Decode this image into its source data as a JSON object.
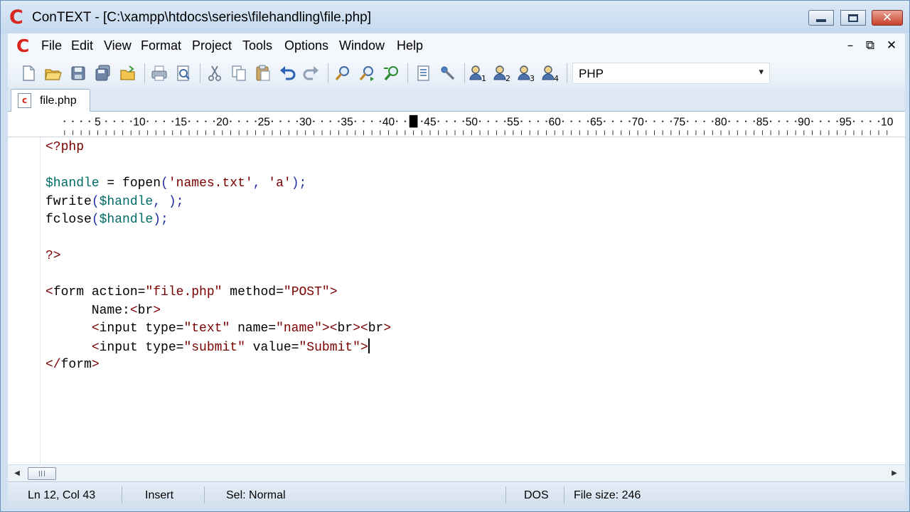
{
  "window": {
    "title": "ConTEXT - [C:\\xampp\\htdocs\\series\\filehandling\\file.php]",
    "app_logo": "C",
    "controls": {
      "minimize": "minimize-icon",
      "maximize": "maximize-icon",
      "close": "close-icon"
    },
    "close_color": "#c7402a"
  },
  "menu": {
    "logo": "C",
    "items": [
      "File",
      "Edit",
      "View",
      "Format",
      "Project",
      "Tools",
      "Options",
      "Window",
      "Help"
    ],
    "mdi_controls": {
      "minimize": "–",
      "restore": "⧉",
      "close": "✕"
    }
  },
  "toolbar": {
    "icons": [
      "new-file-icon",
      "open-file-icon",
      "save-icon",
      "save-all-icon",
      "open-folder-icon",
      "print-icon",
      "print-preview-icon",
      "cut-icon",
      "copy-icon",
      "paste-icon",
      "undo-icon",
      "redo-icon",
      "find-icon",
      "find-next-icon",
      "replace-icon",
      "properties-icon",
      "tools-icon",
      "user-exec-1-icon",
      "user-exec-2-icon",
      "user-exec-3-icon",
      "user-exec-4-icon"
    ],
    "syntax_highlighter": {
      "selected": "PHP",
      "arrow": "▾"
    }
  },
  "tabs": [
    {
      "label": "file.php",
      "icon": "c",
      "active": true
    }
  ],
  "ruler": {
    "labels": [
      "5",
      "10",
      "15",
      "20",
      "25",
      "30",
      "35",
      "40",
      "45",
      "50",
      "55",
      "60",
      "65",
      "70",
      "75",
      "80",
      "85",
      "90",
      "95",
      "10"
    ],
    "cursor_column": 43
  },
  "editor": {
    "lines": [
      [
        {
          "t": "tag",
          "v": "<?php"
        }
      ],
      [],
      [
        {
          "t": "var",
          "v": "$handle"
        },
        {
          "t": "text",
          "v": " = "
        },
        {
          "t": "fn",
          "v": "fopen"
        },
        {
          "t": "punc",
          "v": "("
        },
        {
          "t": "str",
          "v": "'names.txt'"
        },
        {
          "t": "punc",
          "v": ", "
        },
        {
          "t": "str",
          "v": "'a'"
        },
        {
          "t": "punc",
          "v": ");"
        }
      ],
      [
        {
          "t": "fn",
          "v": "fwrite"
        },
        {
          "t": "punc",
          "v": "("
        },
        {
          "t": "var",
          "v": "$handle"
        },
        {
          "t": "punc",
          "v": ", );"
        }
      ],
      [
        {
          "t": "fn",
          "v": "fclose"
        },
        {
          "t": "punc",
          "v": "("
        },
        {
          "t": "var",
          "v": "$handle"
        },
        {
          "t": "punc",
          "v": ");"
        }
      ],
      [],
      [
        {
          "t": "tag",
          "v": "?>"
        }
      ],
      [],
      [
        {
          "t": "tag",
          "v": "<"
        },
        {
          "t": "kw",
          "v": "form action="
        },
        {
          "t": "str",
          "v": "\"file.php\""
        },
        {
          "t": "kw",
          "v": " method="
        },
        {
          "t": "str",
          "v": "\"POST\""
        },
        {
          "t": "tag",
          "v": ">"
        }
      ],
      [
        {
          "t": "text",
          "v": "      Name:"
        },
        {
          "t": "tag",
          "v": "<"
        },
        {
          "t": "kw",
          "v": "br"
        },
        {
          "t": "tag",
          "v": ">"
        }
      ],
      [
        {
          "t": "text",
          "v": "      "
        },
        {
          "t": "tag",
          "v": "<"
        },
        {
          "t": "kw",
          "v": "input type="
        },
        {
          "t": "str",
          "v": "\"text\""
        },
        {
          "t": "kw",
          "v": " name="
        },
        {
          "t": "str",
          "v": "\"name\""
        },
        {
          "t": "tag",
          "v": "><"
        },
        {
          "t": "kw",
          "v": "br"
        },
        {
          "t": "tag",
          "v": "><"
        },
        {
          "t": "kw",
          "v": "br"
        },
        {
          "t": "tag",
          "v": ">"
        }
      ],
      [
        {
          "t": "text",
          "v": "      "
        },
        {
          "t": "tag",
          "v": "<"
        },
        {
          "t": "kw",
          "v": "input type="
        },
        {
          "t": "str",
          "v": "\"submit\""
        },
        {
          "t": "kw",
          "v": " value="
        },
        {
          "t": "str",
          "v": "\"Submit\""
        },
        {
          "t": "tag",
          "v": ">"
        },
        {
          "t": "caret",
          "v": ""
        }
      ],
      [
        {
          "t": "tag",
          "v": "</"
        },
        {
          "t": "kw",
          "v": "form"
        },
        {
          "t": "tag",
          "v": ">"
        }
      ]
    ]
  },
  "scrollbar": {
    "left_arrow": "◀",
    "right_arrow": "▶",
    "thumb_position": 0
  },
  "status": {
    "position": "Ln 12, Col 43",
    "mode": "Insert",
    "selection": "Sel: Normal",
    "line_endings": "DOS",
    "file_size": "File size: 246"
  }
}
